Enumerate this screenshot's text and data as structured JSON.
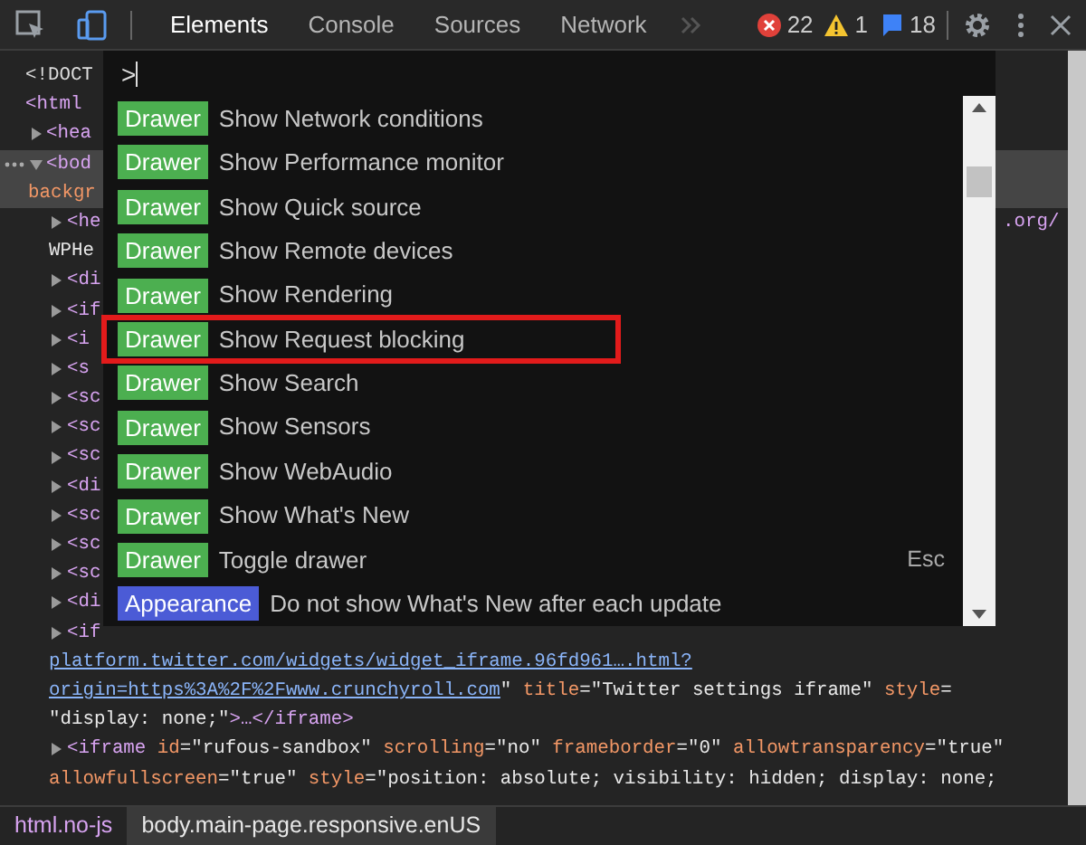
{
  "toolbar": {
    "tools": [
      {
        "kind": "inspect",
        "selected": false
      },
      {
        "kind": "device",
        "selected": true
      }
    ],
    "tabs": [
      {
        "label": "Elements",
        "selected": true
      },
      {
        "label": "Console",
        "selected": false
      },
      {
        "label": "Sources",
        "selected": false
      },
      {
        "label": "Network",
        "selected": false
      }
    ],
    "counters": [
      {
        "kind": "error",
        "count": "22"
      },
      {
        "kind": "warning",
        "count": "1"
      },
      {
        "kind": "info",
        "count": "18"
      }
    ]
  },
  "dom_tree": [
    {
      "segments": [
        {
          "kind": "plain",
          "text": "<!DOCT"
        }
      ]
    },
    {
      "segments": [
        {
          "kind": "tag",
          "text": "<html"
        }
      ],
      "children": [
        {
          "expanded": false,
          "segments": [
            {
              "kind": "tag",
              "text": "<hea"
            }
          ]
        },
        {
          "expanded": true,
          "selected": true,
          "segments": [
            {
              "kind": "tag",
              "text": "<bod"
            }
          ],
          "wrap": [
            [
              {
                "kind": "attr",
                "text": "backgr"
              }
            ]
          ],
          "children": [
            {
              "expanded": false,
              "segments": [
                {
                  "kind": "tag",
                  "text": "<he"
                }
              ],
              "right": ".org/",
              "wrap": [
                [
                  {
                    "kind": "value",
                    "text": "WPHe"
                  }
                ]
              ]
            },
            {
              "expanded": false,
              "segments": [
                {
                  "kind": "tag",
                  "text": "<di"
                }
              ]
            },
            {
              "expanded": false,
              "segments": [
                {
                  "kind": "tag",
                  "text": "<if"
                }
              ]
            },
            {
              "expanded": false,
              "segments": [
                {
                  "kind": "tag",
                  "text": "<i"
                }
              ]
            },
            {
              "expanded": false,
              "segments": [
                {
                  "kind": "tag",
                  "text": "<s"
                }
              ]
            },
            {
              "expanded": false,
              "segments": [
                {
                  "kind": "tag",
                  "text": "<sc"
                }
              ]
            },
            {
              "expanded": false,
              "segments": [
                {
                  "kind": "tag",
                  "text": "<sc"
                }
              ]
            },
            {
              "expanded": false,
              "segments": [
                {
                  "kind": "tag",
                  "text": "<sc"
                }
              ]
            },
            {
              "expanded": false,
              "segments": [
                {
                  "kind": "tag",
                  "text": "<di"
                }
              ]
            },
            {
              "expanded": false,
              "segments": [
                {
                  "kind": "tag",
                  "text": "<sc"
                }
              ]
            },
            {
              "expanded": false,
              "segments": [
                {
                  "kind": "tag",
                  "text": "<sc"
                }
              ]
            },
            {
              "expanded": false,
              "segments": [
                {
                  "kind": "tag",
                  "text": "<sc"
                }
              ]
            },
            {
              "expanded": false,
              "segments": [
                {
                  "kind": "tag",
                  "text": "<di"
                }
              ]
            },
            {
              "expanded": false,
              "segments": [
                {
                  "kind": "tag",
                  "text": "<if"
                }
              ],
              "wrap": [
                [
                  {
                    "kind": "link",
                    "text": "platform.twitter.com/widgets/widget_iframe.96fd961….html?"
                  }
                ],
                [
                  {
                    "kind": "link",
                    "text": "origin=https%3A%2F%2Fwww.crunchyroll.com"
                  },
                  {
                    "kind": "value",
                    "text": "\" "
                  },
                  {
                    "kind": "attr",
                    "text": "title"
                  },
                  {
                    "kind": "value",
                    "text": "=\"Twitter settings iframe\" "
                  },
                  {
                    "kind": "attr",
                    "text": "style"
                  },
                  {
                    "kind": "value",
                    "text": "="
                  }
                ],
                [
                  {
                    "kind": "value",
                    "text": "\"display: none;\""
                  },
                  {
                    "kind": "tag",
                    "text": ">…</iframe>"
                  }
                ]
              ]
            },
            {
              "expanded": false,
              "segments": [
                {
                  "kind": "tag",
                  "text": "<iframe "
                },
                {
                  "kind": "attr",
                  "text": "id"
                },
                {
                  "kind": "value",
                  "text": "=\"rufous-sandbox\" "
                },
                {
                  "kind": "attr",
                  "text": "scrolling"
                },
                {
                  "kind": "value",
                  "text": "=\"no\" "
                },
                {
                  "kind": "attr",
                  "text": "frameborder"
                },
                {
                  "kind": "value",
                  "text": "=\"0\" "
                },
                {
                  "kind": "attr",
                  "text": "allowtransparency"
                },
                {
                  "kind": "value",
                  "text": "=\"true\""
                }
              ],
              "wrap": [
                [
                  {
                    "kind": "attr",
                    "text": "allowfullscreen"
                  },
                  {
                    "kind": "value",
                    "text": "=\"true\" "
                  },
                  {
                    "kind": "attr",
                    "text": "style"
                  },
                  {
                    "kind": "value",
                    "text": "=\"position: absolute; visibility: hidden; display: none;"
                  }
                ]
              ]
            }
          ]
        }
      ]
    }
  ],
  "command_menu": {
    "query": ">",
    "items": [
      {
        "category": {
          "kind": "drawer",
          "label": "Drawer"
        },
        "label": "Show Network conditions",
        "highlighted": false
      },
      {
        "category": {
          "kind": "drawer",
          "label": "Drawer"
        },
        "label": "Show Performance monitor",
        "highlighted": false
      },
      {
        "category": {
          "kind": "drawer",
          "label": "Drawer"
        },
        "label": "Show Quick source",
        "highlighted": false
      },
      {
        "category": {
          "kind": "drawer",
          "label": "Drawer"
        },
        "label": "Show Remote devices",
        "highlighted": false
      },
      {
        "category": {
          "kind": "drawer",
          "label": "Drawer"
        },
        "label": "Show Rendering",
        "highlighted": false
      },
      {
        "category": {
          "kind": "drawer",
          "label": "Drawer"
        },
        "label": "Show Request blocking",
        "highlighted": true
      },
      {
        "category": {
          "kind": "drawer",
          "label": "Drawer"
        },
        "label": "Show Search",
        "highlighted": false
      },
      {
        "category": {
          "kind": "drawer",
          "label": "Drawer"
        },
        "label": "Show Sensors",
        "highlighted": false
      },
      {
        "category": {
          "kind": "drawer",
          "label": "Drawer"
        },
        "label": "Show WebAudio",
        "highlighted": false
      },
      {
        "category": {
          "kind": "drawer",
          "label": "Drawer"
        },
        "label": "Show What's New",
        "highlighted": false
      },
      {
        "category": {
          "kind": "drawer",
          "label": "Drawer"
        },
        "label": "Toggle drawer",
        "shortcut": "Esc",
        "highlighted": false
      },
      {
        "category": {
          "kind": "appearance",
          "label": "Appearance"
        },
        "label": "Do not show What's New after each update",
        "highlighted": false
      }
    ]
  },
  "breadcrumbs": [
    {
      "label": "html.no-js",
      "selected": false
    },
    {
      "label": "body.main-page.responsive.enUS",
      "selected": true
    }
  ]
}
